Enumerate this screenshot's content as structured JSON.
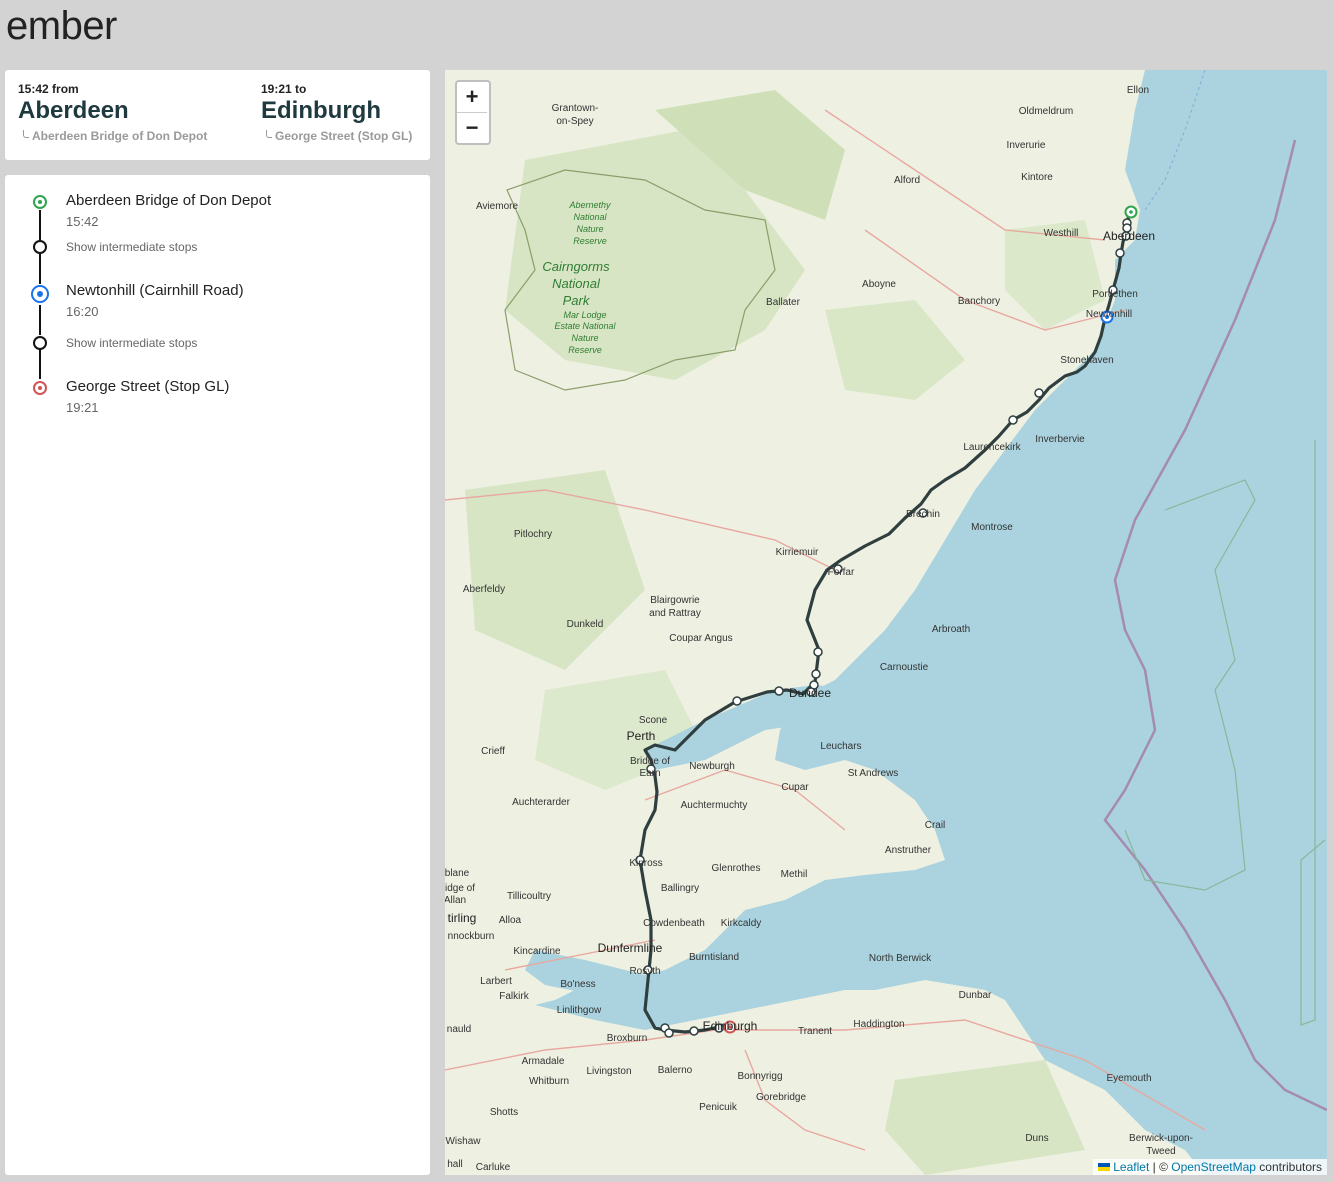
{
  "app": {
    "brand": "ember"
  },
  "trip": {
    "from": {
      "time_label": "15:42 from",
      "city": "Aberdeen",
      "stop": "Aberdeen Bridge of Don Depot"
    },
    "to": {
      "time_label": "19:21 to",
      "city": "Edinburgh",
      "stop": "George Street (Stop GL)"
    }
  },
  "itinerary": {
    "stops": [
      {
        "name": "Aberdeen Bridge of Don Depot",
        "time": "15:42",
        "kind": "origin"
      },
      {
        "name": "Newtonhill (Cairnhill Road)",
        "time": "16:20",
        "kind": "boarding"
      },
      {
        "name": "George Street (Stop GL)",
        "time": "19:21",
        "kind": "destination"
      }
    ],
    "intermediate_1": "Show intermediate stops",
    "intermediate_2": "Show intermediate stops"
  },
  "map": {
    "zoom_in": "+",
    "zoom_out": "−",
    "attribution": {
      "leaflet": "Leaflet",
      "sep": " | © ",
      "osm": "OpenStreetMap",
      "suffix": " contributors"
    },
    "colors": {
      "sea": "#aad3df",
      "land": "#f2efe9",
      "route": "#2f3f3f",
      "origin": "#2ea44f",
      "boarding": "#1a73e8",
      "destination": "#d05555"
    },
    "places": {
      "ellon": "Ellon",
      "oldmeldrum": "Oldmeldrum",
      "inverurie": "Inverurie",
      "kintore": "Kintore",
      "alford": "Alford",
      "westhill": "Westhill",
      "aberdeen": "Aberdeen",
      "aboyne": "Aboyne",
      "banchory": "Banchory",
      "ballater": "Ballater",
      "portlethen": "Portlethen",
      "newtonhill": "Newtonhill",
      "stonehaven": "Stonehaven",
      "inverbervie": "Inverbervie",
      "laurencekirk": "Laurencekirk",
      "brechin": "Brechin",
      "montrose": "Montrose",
      "kirriemuir": "Kirriemuir",
      "forfar": "Forfar",
      "arbroath": "Arbroath",
      "carnoustie": "Carnoustie",
      "dundee": "Dundee",
      "pitlochry": "Pitlochry",
      "aberfeldy": "Aberfeldy",
      "dunkeld": "Dunkeld",
      "blairgowrie": "Blairgowrie",
      "rattray": "and Rattray",
      "coupar_angus": "Coupar Angus",
      "scone": "Scone",
      "perth": "Perth",
      "crieff": "Crieff",
      "bridge_of": "Bridge of",
      "earn": "Earn",
      "newburgh": "Newburgh",
      "leuchars": "Leuchars",
      "st_andrews": "St Andrews",
      "cupar": "Cupar",
      "auchtermuchty": "Auchtermuchty",
      "auchterarder": "Auchterarder",
      "crail": "Crail",
      "anstruther": "Anstruther",
      "kinross": "Kinross",
      "glenrothes": "Glenrothes",
      "methil": "Methil",
      "ballingry": "Ballingry",
      "tillicoultry": "Tillicoultry",
      "alloa": "Alloa",
      "cowdenbeath": "Cowdenbeath",
      "kirkcaldy": "Kirkcaldy",
      "dunfermline": "Dunfermline",
      "kincardine": "Kincardine",
      "burntisland": "Burntisland",
      "rosyth": "Rosyth",
      "boness": "Bo'ness",
      "larbert": "Larbert",
      "falkirk": "Falkirk",
      "linlithgow": "Linlithgow",
      "north_berwick": "North Berwick",
      "dunbar": "Dunbar",
      "edinburgh": "Edinburgh",
      "broxburn": "Broxburn",
      "tranent": "Tranent",
      "haddington": "Haddington",
      "armadale": "Armadale",
      "livingston": "Livingston",
      "balerno": "Balerno",
      "bonnyrigg": "Bonnyrigg",
      "whitburn": "Whitburn",
      "penicuik": "Penicuik",
      "gorebridge": "Gorebridge",
      "shotts": "Shotts",
      "eyemouth": "Eyemouth",
      "duns": "Duns",
      "berwick": "Berwick-upon-",
      "tweed": "Tweed",
      "wishaw": "Wishaw",
      "lanark": "Carluke",
      "grantown": "Grantown-",
      "on_spey": "on-Spey",
      "aviemore": "Aviemore",
      "blane": "blane",
      "bridge_allan": "idge of",
      "allan": "Allan",
      "stirling": "tirling",
      "bannockburn": "nnockburn",
      "uphall": "nauld",
      "hall": "hall"
    },
    "park": {
      "cairngorms_1": "Cairngorms",
      "cairngorms_2": "National",
      "cairngorms_3": "Park",
      "abernethy_1": "Abernethy",
      "abernethy_2": "National",
      "abernethy_3": "Nature",
      "abernethy_4": "Reserve",
      "mar_1": "Mar Lodge",
      "mar_2": "Estate National",
      "mar_3": "Nature",
      "mar_4": "Reserve"
    }
  }
}
